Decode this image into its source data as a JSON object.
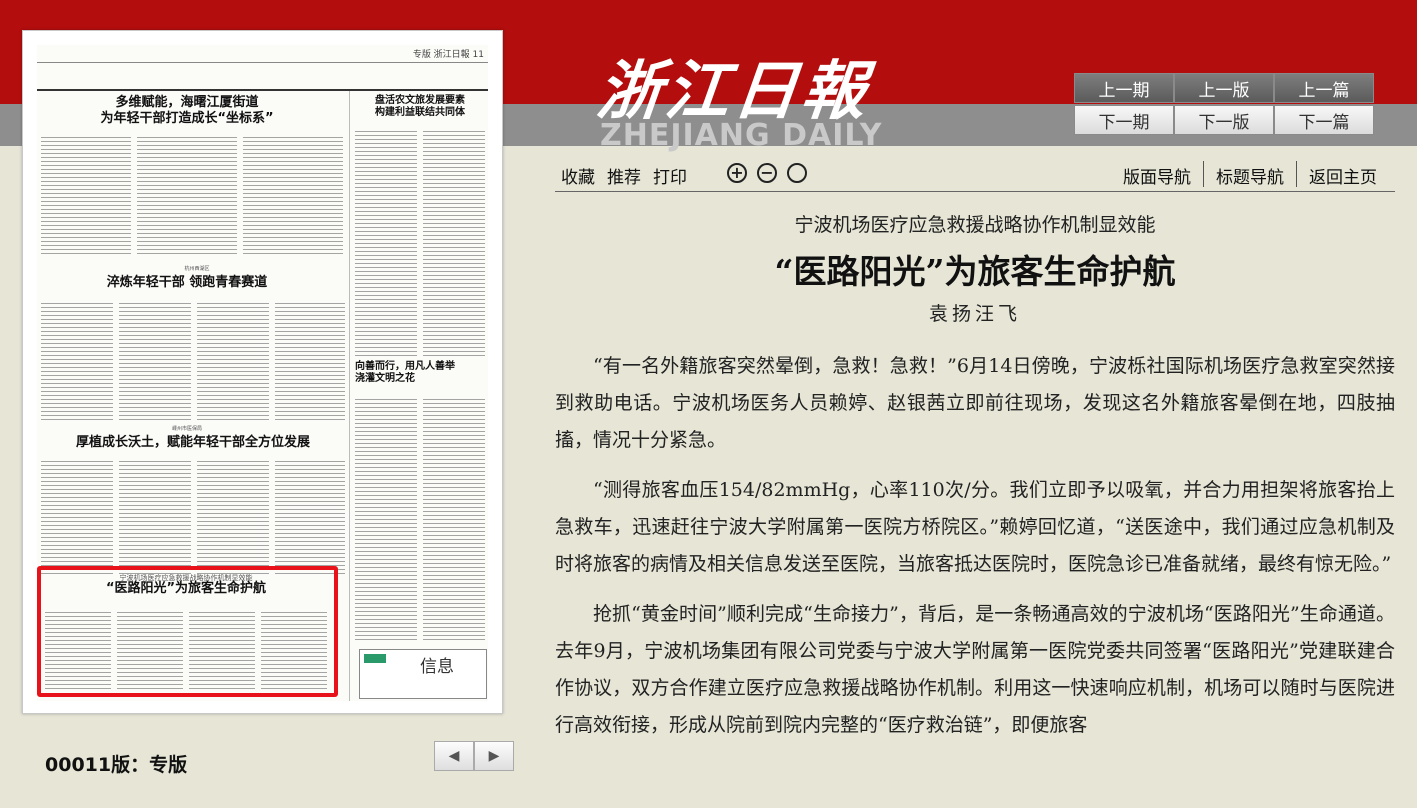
{
  "masthead": {
    "logo_cn": "浙江日報",
    "logo_en": "ZHEJIANG DAILY"
  },
  "nav": {
    "prev_issue": "上一期",
    "prev_page": "上一版",
    "prev_article": "上一篇",
    "next_issue": "下一期",
    "next_page": "下一版",
    "next_article": "下一篇"
  },
  "toolbar": {
    "favorite": "收藏",
    "recommend": "推荐",
    "print": "打印",
    "page_nav": "版面导航",
    "title_nav": "标题导航",
    "home": "返回主页"
  },
  "thumbnail": {
    "page_no": "专版  浙江日報  11",
    "headlines": {
      "h1_line1": "多维赋能，海曙江厦街道",
      "h1_line2": "为年轻干部打造成长“坐标系”",
      "h2_kicker": "杭州西湖区",
      "h2": "淬炼年轻干部  领跑青春赛道",
      "h3_kicker": "嵊州市医保局",
      "h3": "厚植成长沃土，赋能年轻干部全方位发展",
      "h4_line1": "盘活农文旅发展要素",
      "h4_line2": "构建利益联结共同体",
      "h5_line1": "向善而行，用凡人善举",
      "h5_line2": "浇灌文明之花",
      "h6_kicker": "宁波机场医疗应急救援战略协作机制显效能",
      "h6": "“医路阳光”为旅客生命护航",
      "info": "信息"
    }
  },
  "page_label": "00011版：专版",
  "pager": {
    "prev": "◀",
    "next": "▶"
  },
  "article": {
    "subtitle": "宁波机场医疗应急救援战略协作机制显效能",
    "title": "“医路阳光”为旅客生命护航",
    "author": "袁扬汪飞",
    "paragraphs": [
      "“有一名外籍旅客突然晕倒，急救！急救！”6月14日傍晚，宁波栎社国际机场医疗急救室突然接到救助电话。宁波机场医务人员赖婷、赵银茜立即前往现场，发现这名外籍旅客晕倒在地，四肢抽搐，情况十分紧急。",
      "“测得旅客血压154/82mmHg，心率110次/分。我们立即予以吸氧，并合力用担架将旅客抬上急救车，迅速赶往宁波大学附属第一医院方桥院区。”赖婷回忆道，“送医途中，我们通过应急机制及时将旅客的病情及相关信息发送至医院，当旅客抵达医院时，医院急诊已准备就绪，最终有惊无险。”",
      "抢抓“黄金时间”顺利完成“生命接力”，背后，是一条畅通高效的宁波机场“医路阳光”生命通道。去年9月，宁波机场集团有限公司党委与宁波大学附属第一医院党委共同签署“医路阳光”党建联建合作协议，双方合作建立医疗应急救援战略协作机制。利用这一快速响应机制，机场可以随时与医院进行高效衔接，形成从院前到院内完整的“医疗救治链”，即便旅客"
    ]
  }
}
